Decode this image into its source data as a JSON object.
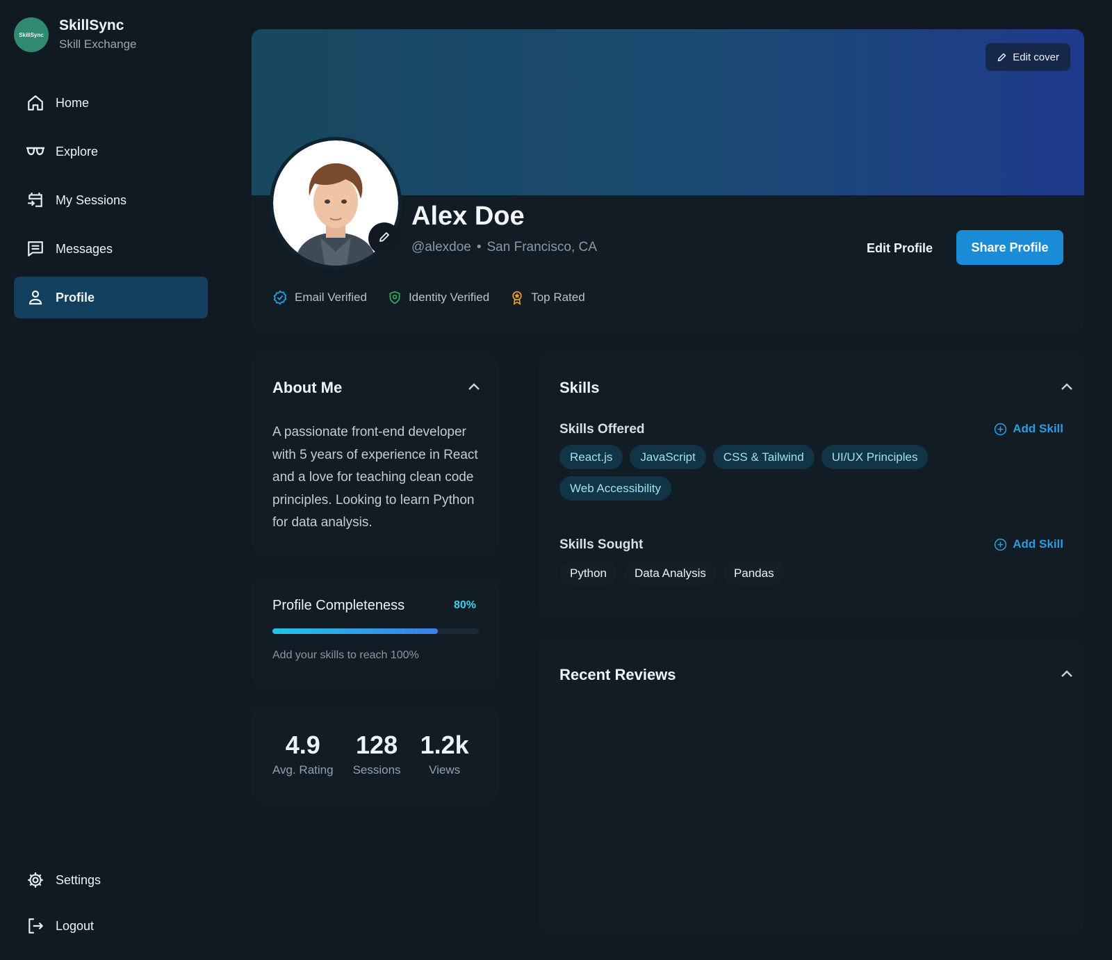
{
  "brand": {
    "logo_text": "SkillSync",
    "name": "SkillSync",
    "subtitle": "Skill Exchange"
  },
  "nav": {
    "items": [
      {
        "label": "Home",
        "icon": "home-icon"
      },
      {
        "label": "Explore",
        "icon": "glasses-icon"
      },
      {
        "label": "My Sessions",
        "icon": "calendar-swap-icon"
      },
      {
        "label": "Messages",
        "icon": "message-icon"
      },
      {
        "label": "Profile",
        "icon": "user-icon",
        "active": true
      }
    ],
    "bottom": [
      {
        "label": "Settings",
        "icon": "gear-icon"
      },
      {
        "label": "Logout",
        "icon": "logout-icon"
      }
    ]
  },
  "profile": {
    "edit_cover_label": "Edit cover",
    "name": "Alex Doe",
    "handle": "@alexdoe",
    "separator": "•",
    "location": "San Francisco, CA",
    "edit_profile_label": "Edit Profile",
    "share_profile_label": "Share Profile",
    "badges": [
      {
        "label": "Email Verified",
        "icon": "verified-badge-icon",
        "color": "#2b9be0"
      },
      {
        "label": "Identity Verified",
        "icon": "shield-check-icon",
        "color": "#2fae5b"
      },
      {
        "label": "Top Rated",
        "icon": "award-icon",
        "color": "#f0a020"
      }
    ]
  },
  "about": {
    "title": "About Me",
    "text": "A passionate front-end developer with 5 years of experience in React and a love for teaching clean code principles. Looking to learn Python for data analysis."
  },
  "completeness": {
    "title": "Profile Completeness",
    "percent_label": "80%",
    "value": 0.8,
    "hint": "Add your skills to reach 100%"
  },
  "stats": [
    {
      "value": "4.9",
      "label": "Avg. Rating"
    },
    {
      "value": "128",
      "label": "Sessions"
    },
    {
      "value": "1.2k",
      "label": "Views"
    }
  ],
  "skills": {
    "title": "Skills",
    "offered_title": "Skills Offered",
    "sought_title": "Skills Sought",
    "add_label": "Add Skill",
    "offered": [
      "React.js",
      "JavaScript",
      "CSS & Tailwind",
      "UI/UX Principles",
      "Web Accessibility"
    ],
    "sought": [
      "Python",
      "Data Analysis",
      "Pandas"
    ]
  },
  "reviews": {
    "title": "Recent Reviews"
  },
  "colors": {
    "accent": "#1a8bd6",
    "active_nav": "#13405e",
    "background": "#111a22"
  }
}
